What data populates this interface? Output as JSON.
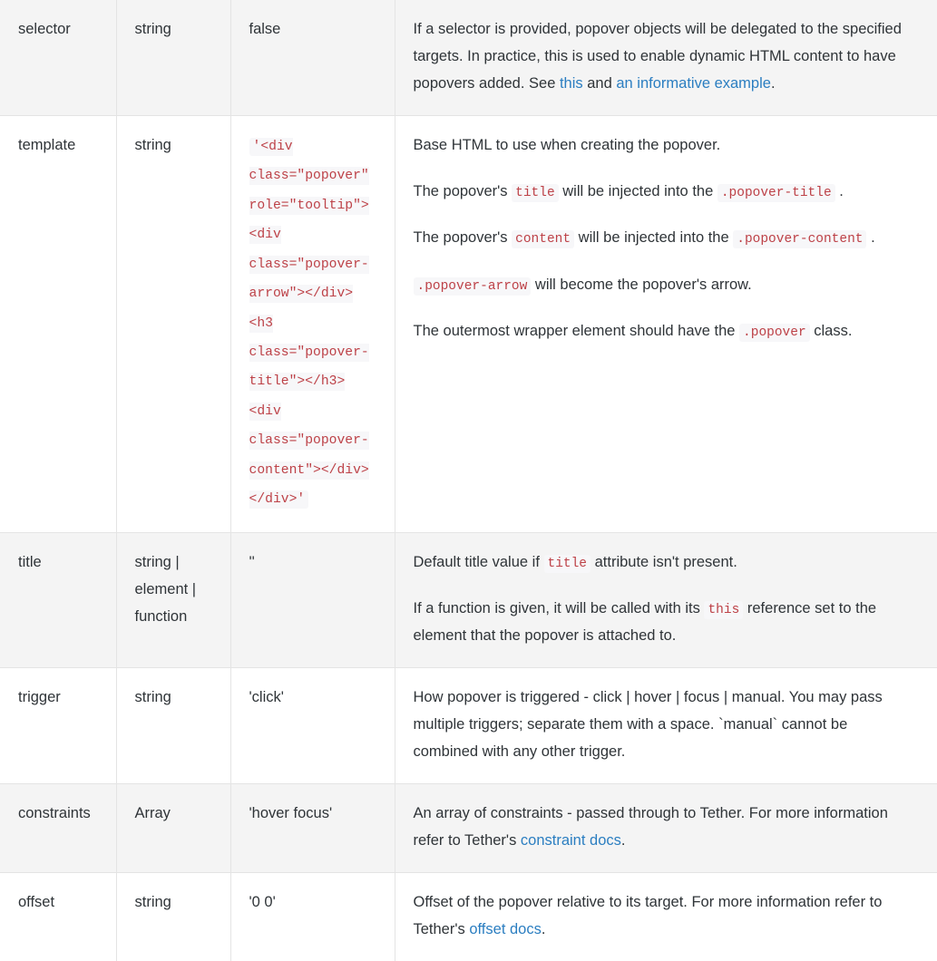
{
  "table": {
    "name": "popover-options-table",
    "rows": [
      {
        "shaded": true,
        "name": "selector",
        "type": "string",
        "default": "false",
        "description_parts": [
          {
            "kind": "p",
            "segments": [
              {
                "t": "text",
                "v": "If a selector is provided, popover objects will be delegated to the specified targets. In practice, this is used to enable dynamic HTML content to have popovers added. See "
              },
              {
                "t": "link",
                "v": "this"
              },
              {
                "t": "text",
                "v": " and "
              },
              {
                "t": "link",
                "v": "an informative example"
              },
              {
                "t": "text",
                "v": "."
              }
            ]
          }
        ]
      },
      {
        "shaded": false,
        "name": "template",
        "type": "string",
        "default_code": "'<div class=\"popover\" role=\"tooltip\"><div class=\"popover-arrow\"></div><h3 class=\"popover-title\"></h3><div class=\"popover-content\"></div></div>'",
        "description_parts": [
          {
            "kind": "p",
            "segments": [
              {
                "t": "text",
                "v": "Base HTML to use when creating the popover."
              }
            ]
          },
          {
            "kind": "p",
            "segments": [
              {
                "t": "text",
                "v": "The popover's "
              },
              {
                "t": "code",
                "v": "title"
              },
              {
                "t": "text",
                "v": " will be injected into the "
              },
              {
                "t": "code",
                "v": ".popover-title"
              },
              {
                "t": "text",
                "v": " ."
              }
            ]
          },
          {
            "kind": "p",
            "segments": [
              {
                "t": "text",
                "v": "The popover's "
              },
              {
                "t": "code",
                "v": "content"
              },
              {
                "t": "text",
                "v": " will be injected into the "
              },
              {
                "t": "code",
                "v": ".popover-content"
              },
              {
                "t": "text",
                "v": " ."
              }
            ]
          },
          {
            "kind": "p",
            "segments": [
              {
                "t": "code",
                "v": ".popover-arrow"
              },
              {
                "t": "text",
                "v": " will become the popover's arrow."
              }
            ]
          },
          {
            "kind": "p",
            "segments": [
              {
                "t": "text",
                "v": "The outermost wrapper element should have the "
              },
              {
                "t": "code",
                "v": ".popover"
              },
              {
                "t": "text",
                "v": " class."
              }
            ]
          }
        ]
      },
      {
        "shaded": true,
        "name": "title",
        "type": "string | element | function",
        "default": "''",
        "description_parts": [
          {
            "kind": "p",
            "segments": [
              {
                "t": "text",
                "v": "Default title value if "
              },
              {
                "t": "code",
                "v": "title"
              },
              {
                "t": "text",
                "v": " attribute isn't present."
              }
            ]
          },
          {
            "kind": "p",
            "segments": [
              {
                "t": "text",
                "v": "If a function is given, it will be called with its "
              },
              {
                "t": "code",
                "v": "this"
              },
              {
                "t": "text",
                "v": " reference set to the element that the popover is attached to."
              }
            ]
          }
        ]
      },
      {
        "shaded": false,
        "name": "trigger",
        "type": "string",
        "default": "'click'",
        "description_parts": [
          {
            "kind": "p",
            "segments": [
              {
                "t": "text",
                "v": "How popover is triggered - click | hover | focus | manual. You may pass multiple triggers; separate them with a space. `manual` cannot be combined with any other trigger."
              }
            ]
          }
        ]
      },
      {
        "shaded": true,
        "name": "constraints",
        "type": "Array",
        "default": "'hover focus'",
        "description_parts": [
          {
            "kind": "p",
            "segments": [
              {
                "t": "text",
                "v": "An array of constraints - passed through to Tether. For more information refer to Tether's "
              },
              {
                "t": "link",
                "v": "constraint docs"
              },
              {
                "t": "text",
                "v": "."
              }
            ]
          }
        ]
      },
      {
        "shaded": false,
        "name": "offset",
        "type": "string",
        "default": "'0 0'",
        "description_parts": [
          {
            "kind": "p",
            "segments": [
              {
                "t": "text",
                "v": "Offset of the popover relative to its target. For more information refer to Tether's "
              },
              {
                "t": "link",
                "v": "offset docs"
              },
              {
                "t": "text",
                "v": "."
              }
            ]
          }
        ]
      }
    ]
  },
  "colors": {
    "code_text": "#bd4147",
    "code_bg": "#f7f7f9",
    "link": "#2b7ec1",
    "row_shaded_bg": "#f4f4f4",
    "row_plain_bg": "#ffffff",
    "border": "#e4e4e4",
    "text": "#2f3438"
  }
}
